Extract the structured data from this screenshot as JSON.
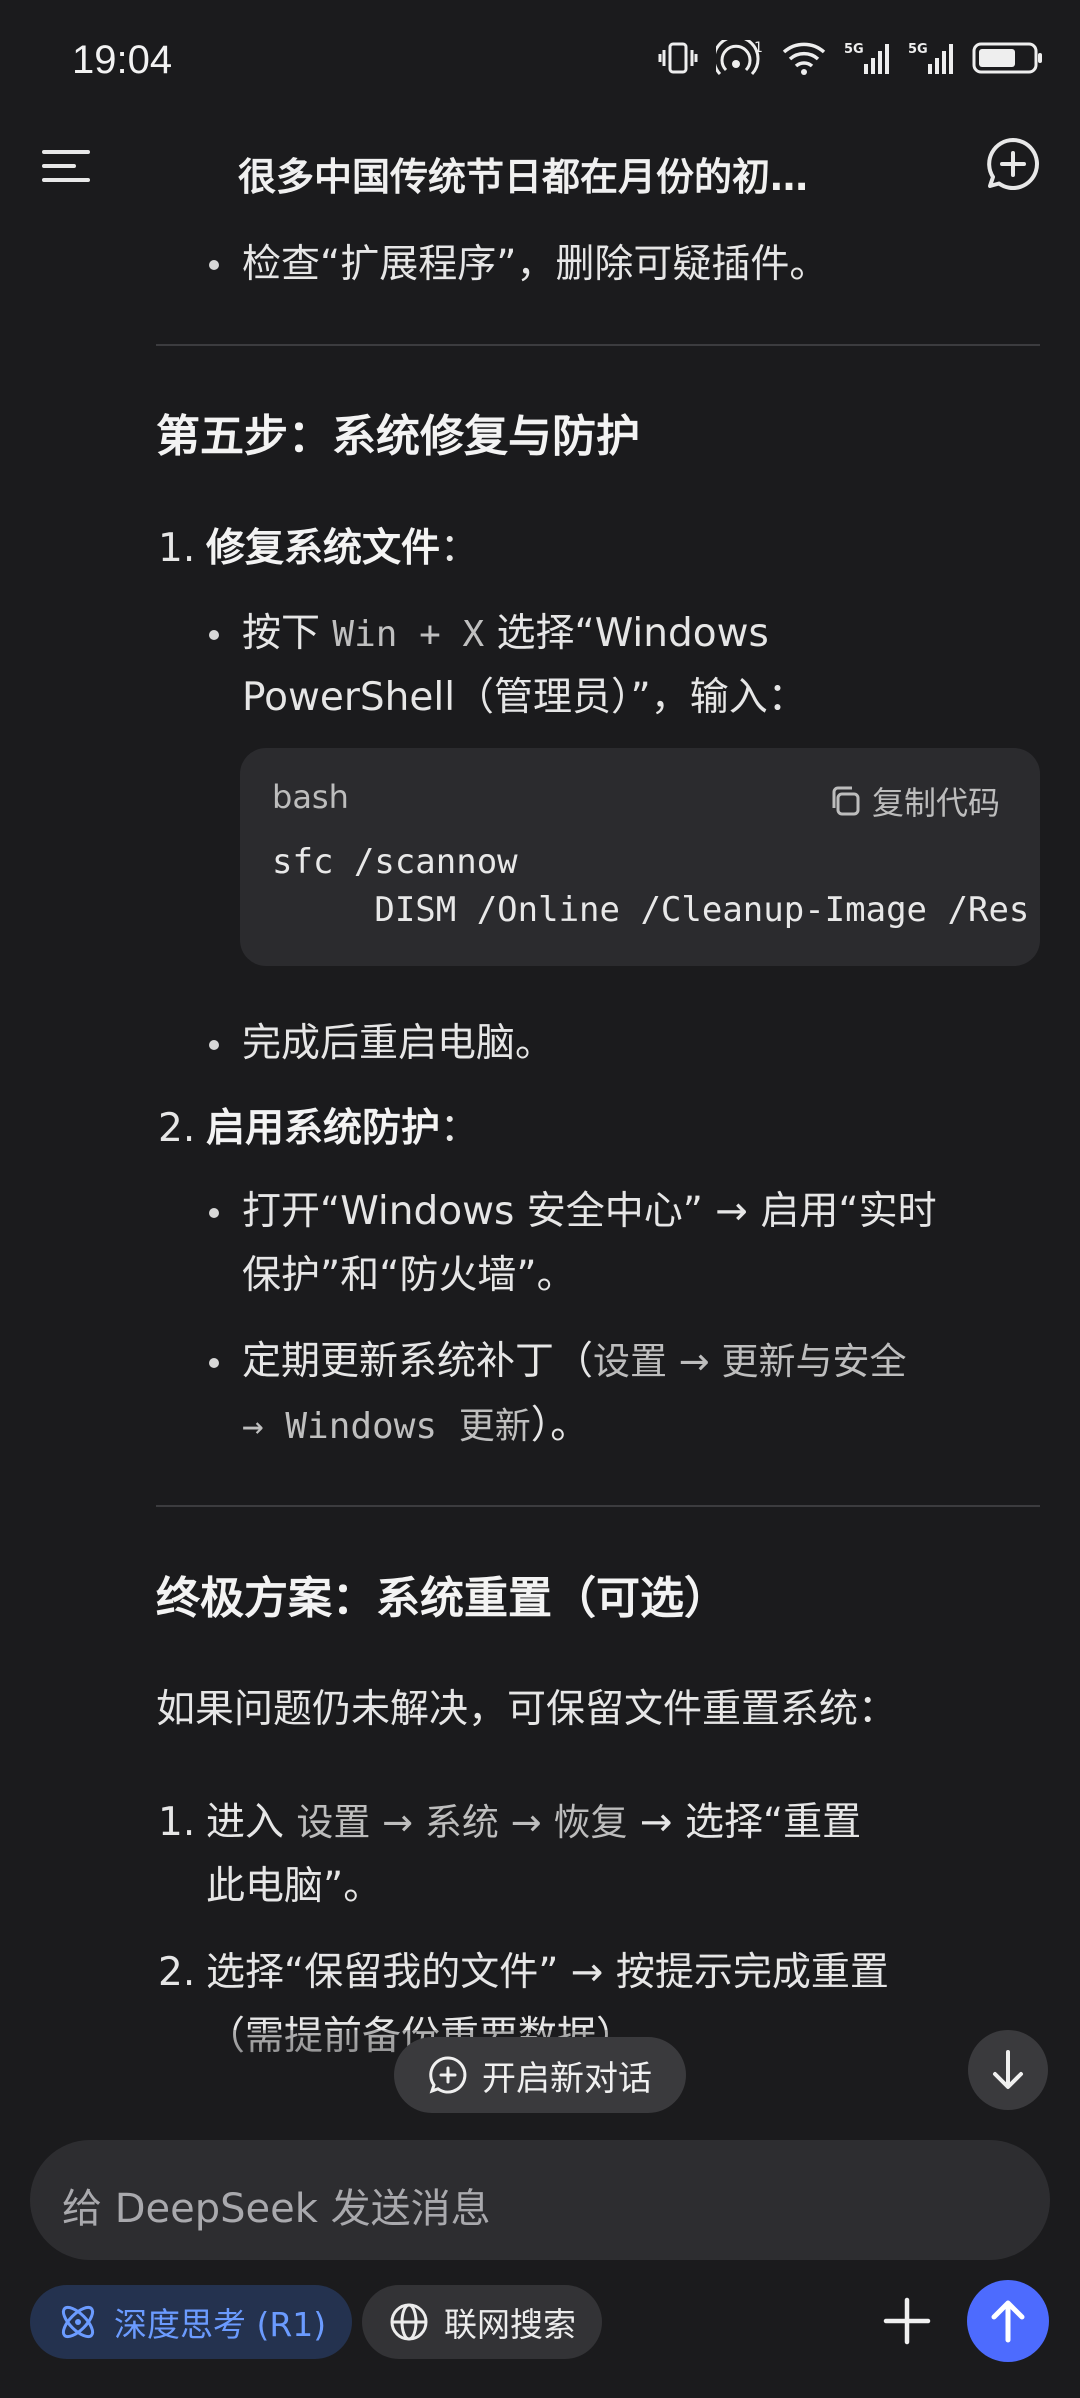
{
  "status": {
    "time": "19:04",
    "net1": "5G",
    "net2": "5G",
    "sim": "1"
  },
  "header": {
    "title": "很多中国传统节日都在月份的初…"
  },
  "content": {
    "top_bullet": "检查“扩展程序”，删除可疑插件。",
    "step5_heading": "第五步：系统修复与防护",
    "item1_num": "1.",
    "item1_label": "修复系统文件",
    "item1_colon": "：",
    "item1_b1_pre": "按下 ",
    "item1_b1_code": "Win + X",
    "item1_b1_post": " 选择“Windows",
    "item1_b1_line2": "PowerShell（管理员）”，输入：",
    "code_lang": "bash",
    "copy_label": "复制代码",
    "code_line1": "sfc /scannow",
    "code_line2": "     DISM /Online /Cleanup-Image /Res",
    "item1_b2": "完成后重启电脑。",
    "item2_num": "2.",
    "item2_label": "启用系统防护",
    "item2_colon": "：",
    "item2_b1_l1": "打开“Windows 安全中心” → 启用“实时",
    "item2_b1_l2": "保护”和“防火墙”。",
    "item2_b2_l1_pre": "定期更新系统补丁（",
    "item2_b2_l1_code": "设置 → 更新与安全",
    "item2_b2_l2_code": "→ Windows 更新",
    "item2_b2_l2_post": "）。",
    "final_heading": "终极方案：系统重置（可选）",
    "final_para": "如果问题仍未解决，可保留文件重置系统：",
    "f1_num": "1.",
    "f1_pre": "进入 ",
    "f1_code": "设置 → 系统 → 恢复",
    "f1_post": " → 选择“重置",
    "f1_l2": "此电脑”。",
    "f2_num": "2.",
    "f2_l1": "选择“保留我的文件” → 按提示完成重置",
    "f2_l2": "（需提前备份重要数据）。"
  },
  "floating": {
    "new_chat": "开启新对话"
  },
  "composer": {
    "placeholder": "给 DeepSeek 发送消息",
    "deep_think": "深度思考 (R1)",
    "web_search": "联网搜索"
  },
  "colors": {
    "background": "#1b1b1d",
    "accent": "#4d6bfe",
    "deep_chip_text": "#6b9bff"
  }
}
